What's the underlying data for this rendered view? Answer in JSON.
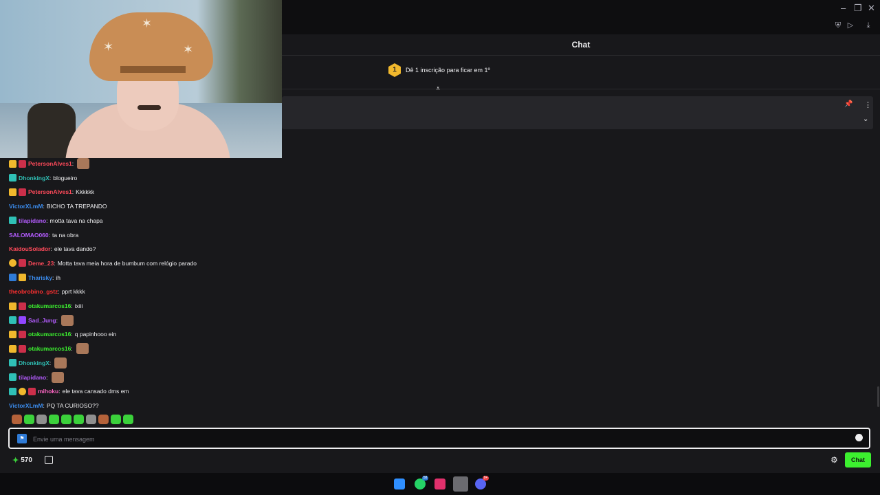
{
  "header": {
    "title": "Chat"
  },
  "leaderboard": {
    "rank": "1",
    "text": "Dê 1 inscrição para ficar em 1º"
  },
  "messages": [
    {
      "badges": [
        "crown",
        "heart"
      ],
      "user": "PetersonAlves1",
      "color": "#ff4a5a",
      "text": "",
      "emote": true
    },
    {
      "badges": [
        "sub"
      ],
      "user": "DhonkingX",
      "color": "#2fc0b6",
      "text": "blogueiro",
      "emote": false
    },
    {
      "badges": [
        "crown",
        "heart"
      ],
      "user": "PetersonAlves1",
      "color": "#ff4a5a",
      "text": "Kkkkkk",
      "emote": false
    },
    {
      "badges": [],
      "user": "VictorXLmM",
      "color": "#3b8df0",
      "text": "BICHO TA TREPANDO",
      "emote": false
    },
    {
      "badges": [
        "sub"
      ],
      "user": "tilapidano",
      "color": "#b45cff",
      "text": "motta tava na chapa",
      "emote": false
    },
    {
      "badges": [],
      "user": "SALOMAO060",
      "color": "#b45cff",
      "text": "ta na obra",
      "emote": false
    },
    {
      "badges": [],
      "user": "KaidouSolador",
      "color": "#ff4a5a",
      "text": "ele tava dando?",
      "emote": false
    },
    {
      "badges": [
        "coin",
        "heart"
      ],
      "user": "Deme_23",
      "color": "#ff4a5a",
      "text": "Motta tava meia hora de bumbum com relógio parado",
      "emote": false
    },
    {
      "badges": [
        "vip",
        "crown"
      ],
      "user": "Tharisky",
      "color": "#3b8df0",
      "text": "ih",
      "emote": false
    },
    {
      "badges": [],
      "user": "theobrobino_gstz",
      "color": "#ff3030",
      "text": "pprt kkkk",
      "emote": false
    },
    {
      "badges": [
        "crown",
        "heart"
      ],
      "user": "otakumarcos16",
      "color": "#3cf02f",
      "text": "ixiii",
      "emote": false
    },
    {
      "badges": [
        "sub",
        "purple"
      ],
      "user": "Sad_Jung",
      "color": "#b45cff",
      "text": "",
      "emote": true
    },
    {
      "badges": [
        "crown",
        "heart"
      ],
      "user": "otakumarcos16",
      "color": "#3cf02f",
      "text": "q papinhooo ein",
      "emote": false
    },
    {
      "badges": [
        "crown",
        "heart"
      ],
      "user": "otakumarcos16",
      "color": "#3cf02f",
      "text": "",
      "emote": true
    },
    {
      "badges": [
        "sub"
      ],
      "user": "DhonkingX",
      "color": "#2fc0b6",
      "text": "",
      "emote": true
    },
    {
      "badges": [
        "sub"
      ],
      "user": "tilapidano",
      "color": "#b45cff",
      "text": "",
      "emote": true
    },
    {
      "badges": [
        "sub",
        "coin",
        "heart"
      ],
      "user": "mihoku",
      "color": "#ff66c4",
      "text": "ele tava cansado dms em",
      "emote": false
    },
    {
      "badges": [],
      "user": "VictorXLmM",
      "color": "#3b8df0",
      "text": "PQ TA CURIOSO??",
      "emote": false
    }
  ],
  "input": {
    "placeholder": "Envie uma mensagem"
  },
  "footer": {
    "points": "570",
    "chat_button": "Chat"
  },
  "taskbar": {
    "whatsapp_badge": "58",
    "discord_badge": "9+"
  }
}
